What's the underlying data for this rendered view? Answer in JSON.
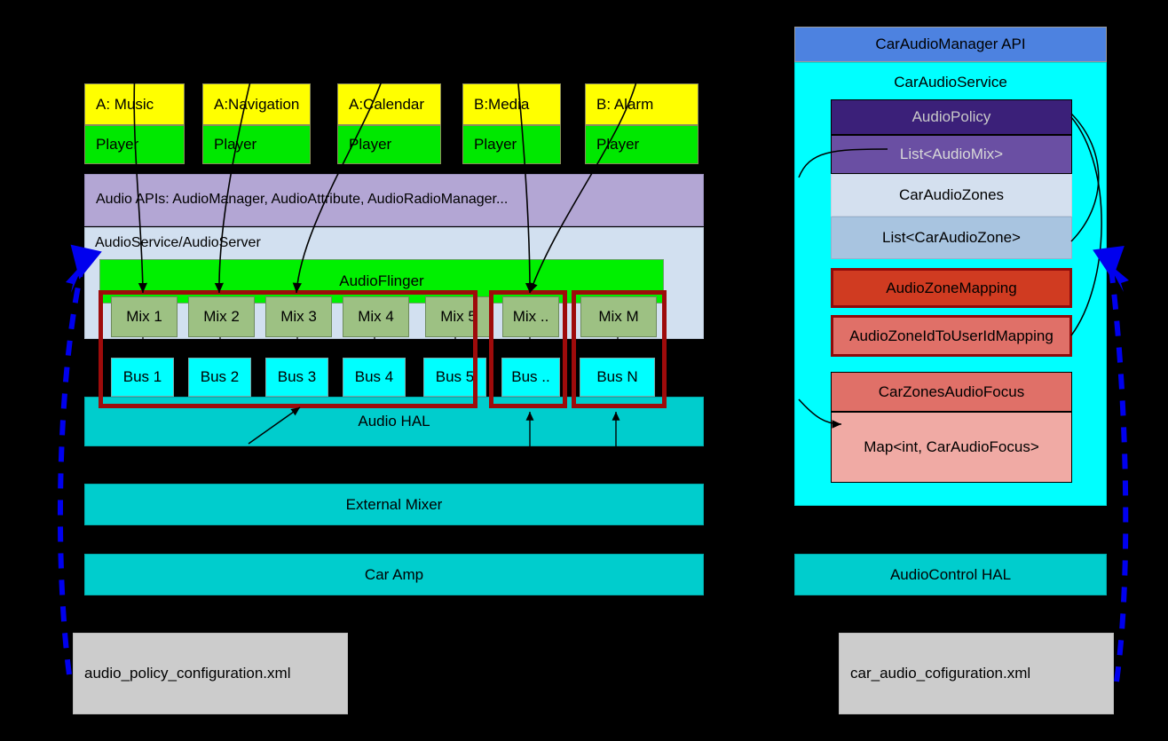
{
  "diagram": {
    "title": "Android Automotive Car Audio Architecture",
    "colors": {
      "app_title_bg": "#ffff00",
      "player_bg": "#00e800",
      "audio_apis_bg": "#b3a6d4",
      "audio_service_bg": "#d2e0f0",
      "audio_flinger_bg": "#00f000",
      "mix_bg": "#9dc183",
      "bus_bg": "#00ffff",
      "hal_bg": "#00cdcd",
      "red_frame": "#9e0b0b",
      "car_audio_manager_api_bg": "#4d82e0",
      "car_audio_service_bg": "#00ffff",
      "audio_policy_bg": "#3b2079",
      "audio_mix_list_bg": "#6a4fa3",
      "car_audio_zones_bg": "#d4e0ef",
      "car_audio_zone_list_bg": "#a8c4e0",
      "audio_zone_mapping_bg": "#d03b21",
      "audio_zone_id_map_bg": "#e07068",
      "focus_top_bg": "#e07068",
      "focus_bottom_bg": "#f0aaa4",
      "xml_bg": "#cccccc",
      "dashed_arrow": "#0000ee",
      "background": "#000000"
    }
  },
  "apps": [
    {
      "title": "A: Music",
      "player": "Player"
    },
    {
      "title": "A:Navigation",
      "player": "Player"
    },
    {
      "title": "A:Calendar",
      "player": "Player"
    },
    {
      "title": "B:Media",
      "player": "Player"
    },
    {
      "title": "B: Alarm",
      "player": "Player"
    }
  ],
  "framework": {
    "audio_apis": "Audio APIs: AudioManager, AudioAttribute, AudioRadioManager...",
    "audio_service": "AudioService/AudioServer",
    "audio_flinger": "AudioFlinger",
    "mixes": [
      "Mix 1",
      "Mix 2",
      "Mix 3",
      "Mix 4",
      "Mix 5",
      "Mix ..",
      "Mix M"
    ],
    "buses": [
      "Bus 1",
      "Bus 2",
      "Bus 3",
      "Bus 4",
      "Bus 5",
      "Bus ..",
      "Bus N"
    ],
    "audio_hal": "Audio HAL",
    "external_mixer": "External Mixer",
    "car_amp": "Car Amp",
    "audio_policy_config_xml": "audio_policy_configuration.xml"
  },
  "car_panel": {
    "api_header": "CarAudioManager API",
    "service_label": "CarAudioService",
    "audio_policy": "AudioPolicy",
    "audio_mix_list": "List<AudioMix>",
    "car_audio_zones": "CarAudioZones",
    "car_audio_zone_list": "List<CarAudioZone>",
    "audio_zone_mapping": "AudioZoneMapping",
    "audio_zone_id_to_user_id_mapping": "AudioZoneIdToUserIdMapping",
    "car_zones_audio_focus": "CarZonesAudioFocus",
    "focus_map": "Map<int, CarAudioFocus>",
    "audio_control_hal": "AudioControl HAL",
    "car_audio_config_xml": "car_audio_cofiguration.xml"
  }
}
